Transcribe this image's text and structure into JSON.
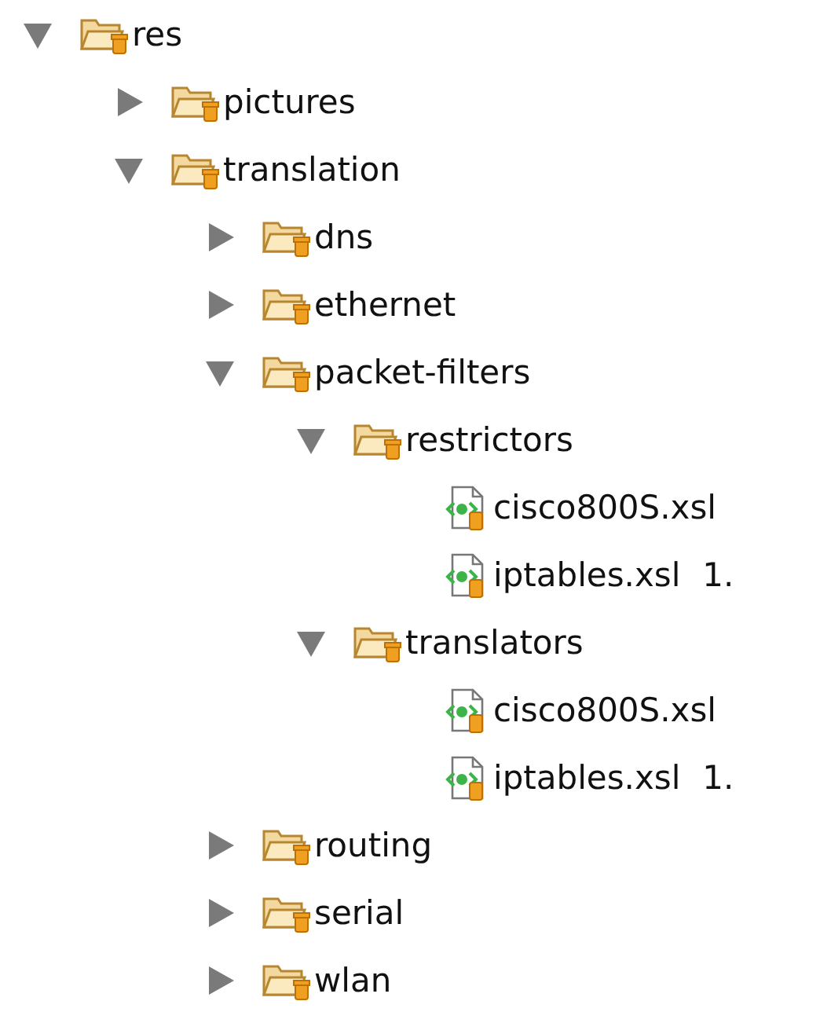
{
  "tree": [
    {
      "name": "res",
      "kind": "folder",
      "expanded": true,
      "children": [
        {
          "name": "pictures",
          "kind": "folder",
          "expanded": false
        },
        {
          "name": "translation",
          "kind": "folder",
          "expanded": true,
          "children": [
            {
              "name": "dns",
              "kind": "folder",
              "expanded": false
            },
            {
              "name": "ethernet",
              "kind": "folder",
              "expanded": false
            },
            {
              "name": "packet-filters",
              "kind": "folder",
              "expanded": true,
              "children": [
                {
                  "name": "restrictors",
                  "kind": "folder",
                  "expanded": true,
                  "children": [
                    {
                      "name": "cisco800S.xsl",
                      "kind": "file"
                    },
                    {
                      "name": "iptables.xsl",
                      "kind": "file",
                      "revision": "1."
                    }
                  ]
                },
                {
                  "name": "translators",
                  "kind": "folder",
                  "expanded": true,
                  "children": [
                    {
                      "name": "cisco800S.xsl",
                      "kind": "file"
                    },
                    {
                      "name": "iptables.xsl",
                      "kind": "file",
                      "revision": "1."
                    }
                  ]
                }
              ]
            },
            {
              "name": "routing",
              "kind": "folder",
              "expanded": false
            },
            {
              "name": "serial",
              "kind": "folder",
              "expanded": false
            },
            {
              "name": "wlan",
              "kind": "folder",
              "expanded": false
            }
          ]
        }
      ]
    }
  ]
}
